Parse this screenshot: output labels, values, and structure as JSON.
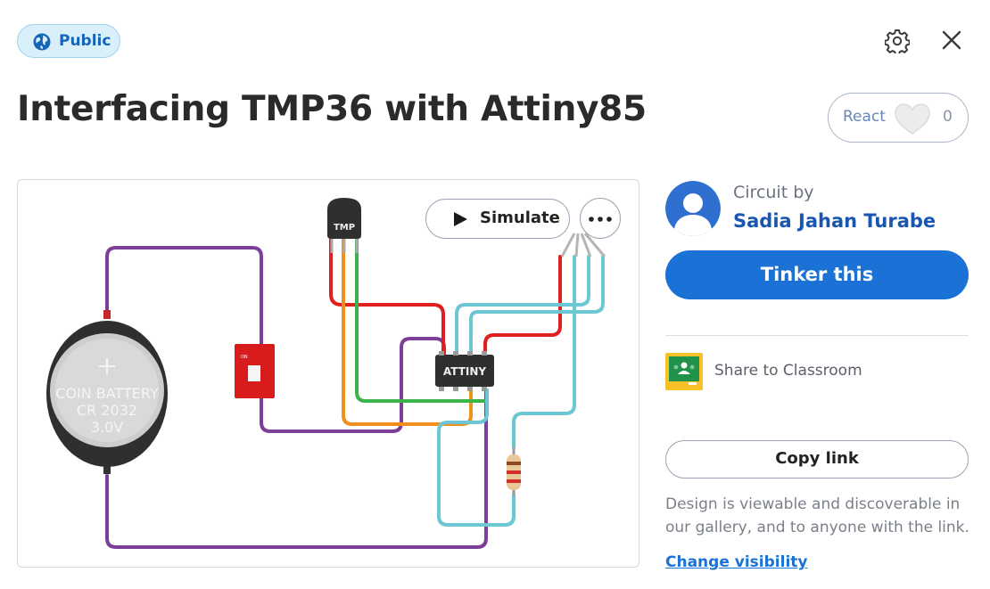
{
  "header": {
    "visibility_badge": "Public",
    "title": "Interfacing TMP36 with Attiny85",
    "react_label": "React",
    "react_count": "0"
  },
  "icons": {
    "globe": "globe-icon",
    "settings": "gear-icon",
    "close": "close-icon",
    "heart": "heart-icon",
    "play": "play-icon",
    "more": "more-options-icon",
    "classroom": "google-classroom-icon"
  },
  "canvas": {
    "simulate_label": "Simulate",
    "battery_line1": "COIN BATTERY",
    "battery_line2": "CR 2032",
    "battery_line3": "3.0V",
    "sensor_label": "TMP",
    "chip_label": "ATTINY",
    "switch_label": "ON"
  },
  "sidebar": {
    "circuit_by": "Circuit by",
    "author": "Sadia Jahan Turabe",
    "tinker_button": "Tinker this",
    "share_classroom": "Share to Classroom",
    "copy_link": "Copy link",
    "visibility_description": "Design is viewable and discoverable in our gallery, and to anyone with the link.",
    "change_visibility": "Change visibility"
  },
  "colors": {
    "accent_blue": "#1b72d6",
    "badge_bg": "#d9f0fb",
    "wire_purple": "#7b3f98",
    "wire_red": "#e02020",
    "wire_green": "#3bb34a",
    "wire_orange": "#f0901c",
    "wire_cyan": "#6cc6d4"
  }
}
